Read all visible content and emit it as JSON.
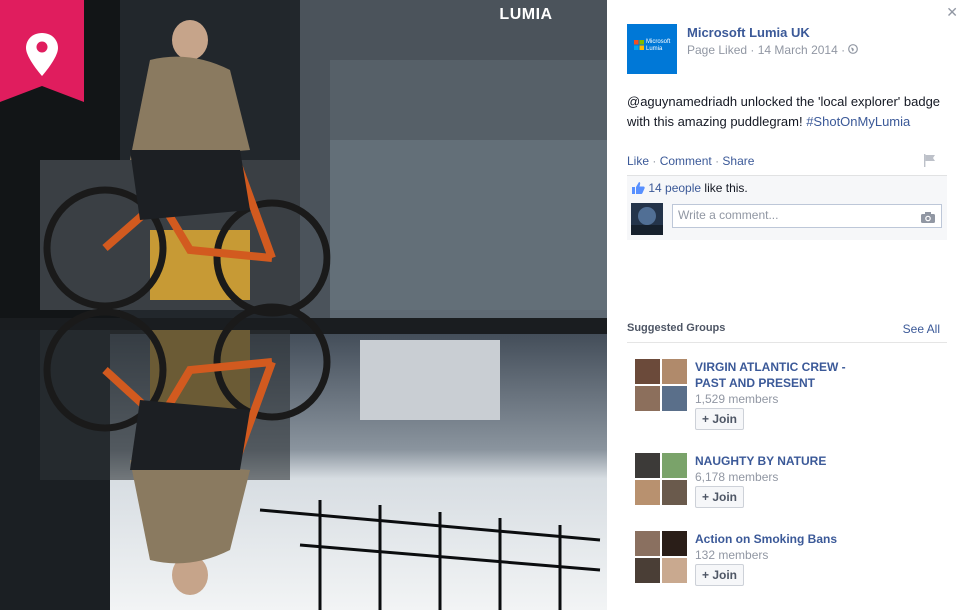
{
  "photo": {
    "badge": {
      "brand": "LUMIA",
      "icon": "map-pin-icon",
      "color": "#e01d5e"
    }
  },
  "post": {
    "page_name": "Microsoft Lumia UK",
    "logo_text": "Microsoft Lumia",
    "meta": "Page Liked · 14 March 2014 ·",
    "caption_text": "@aguynamedriadh unlocked the 'local explorer' badge with this amazing puddlegram! ",
    "caption_hashtag": "#ShotOnMyLumia",
    "actions": {
      "like": "Like",
      "comment": "Comment",
      "share": "Share"
    },
    "likes_link": "14 people",
    "likes_suffix": " like this.",
    "comment_placeholder": "Write a comment..."
  },
  "suggested_groups": {
    "heading": "Suggested Groups",
    "see_all": "See All",
    "groups": [
      {
        "name": "VIRGIN ATLANTIC CREW - PAST AND PRESENT",
        "members": "1,529 members",
        "join": "+ Join"
      },
      {
        "name": "NAUGHTY BY NATURE",
        "members": "6,178 members",
        "join": "+ Join"
      },
      {
        "name": "Action on Smoking Bans",
        "members": "132 members",
        "join": "+ Join"
      }
    ]
  },
  "colors": {
    "link": "#3b5998",
    "muted": "#9197a3",
    "brand_blue": "#0078d7"
  }
}
